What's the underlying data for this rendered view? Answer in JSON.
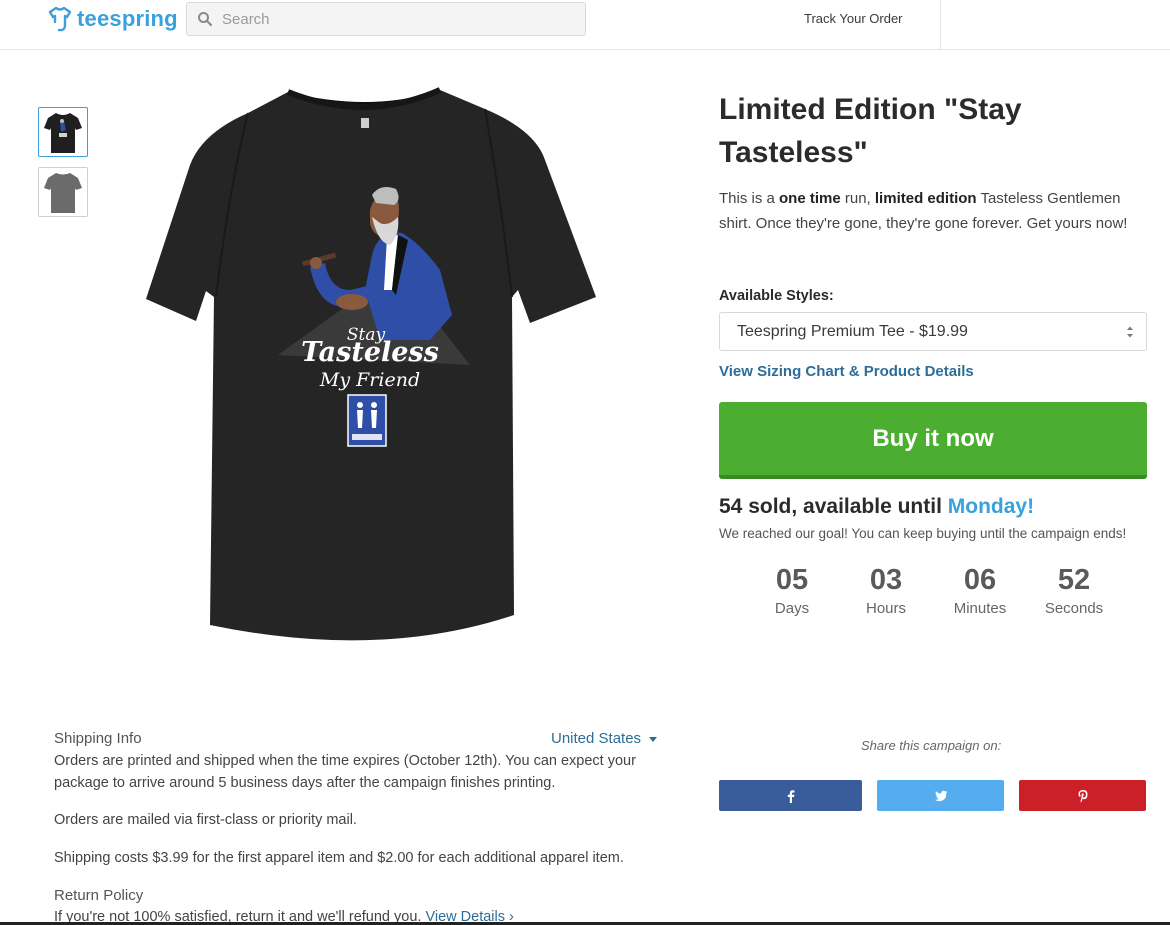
{
  "header": {
    "logo_text": "teespring",
    "search_placeholder": "Search",
    "track_order": "Track Your Order"
  },
  "product": {
    "title": "Limited Edition \"Stay Tasteless\"",
    "description": {
      "part1": "This is a ",
      "bold1": "one time",
      "part2": " run, ",
      "bold2": "limited edition",
      "part3": " Tasteless Gentlemen shirt. Once they're gone, they're gone forever. Get yours now!"
    },
    "styles_label": "Available Styles:",
    "selected_style": "Teespring Premium Tee - $19.99",
    "sizing_link": "View Sizing Chart & Product Details",
    "buy_button": "Buy it now",
    "sold_text": "54 sold, available until ",
    "sold_day": "Monday!",
    "goal_text": "We reached our goal! You can keep buying until the campaign ends!",
    "shirt_text": {
      "line1": "Stay",
      "line2": "Tasteless",
      "line3": "My Friend"
    }
  },
  "countdown": [
    {
      "value": "05",
      "label": "Days"
    },
    {
      "value": "03",
      "label": "Hours"
    },
    {
      "value": "06",
      "label": "Minutes"
    },
    {
      "value": "52",
      "label": "Seconds"
    }
  ],
  "shipping": {
    "heading": "Shipping Info",
    "country": "United States",
    "paragraphs": [
      "Orders are printed and shipped when the time expires (October 12th). You can expect your package to arrive around 5 business days after the campaign finishes printing.",
      "Orders are mailed via first-class or priority mail.",
      "Shipping costs $3.99 for the first apparel item and $2.00 for each additional apparel item."
    ],
    "return_heading": "Return Policy",
    "return_text": "If you're not 100% satisfied, return it and we'll refund you. ",
    "return_link": "View Details ›"
  },
  "share": {
    "label": "Share this campaign on:",
    "buttons": [
      {
        "network": "facebook",
        "icon": "facebook-icon",
        "color": "#3b5c9b"
      },
      {
        "network": "twitter",
        "icon": "twitter-icon",
        "color": "#55acee"
      },
      {
        "network": "pinterest",
        "icon": "pinterest-icon",
        "color": "#cb2027"
      }
    ]
  },
  "colors": {
    "brand_blue": "#3aa1dc",
    "link_blue": "#2c6e99",
    "buy_green": "#4cae30"
  }
}
